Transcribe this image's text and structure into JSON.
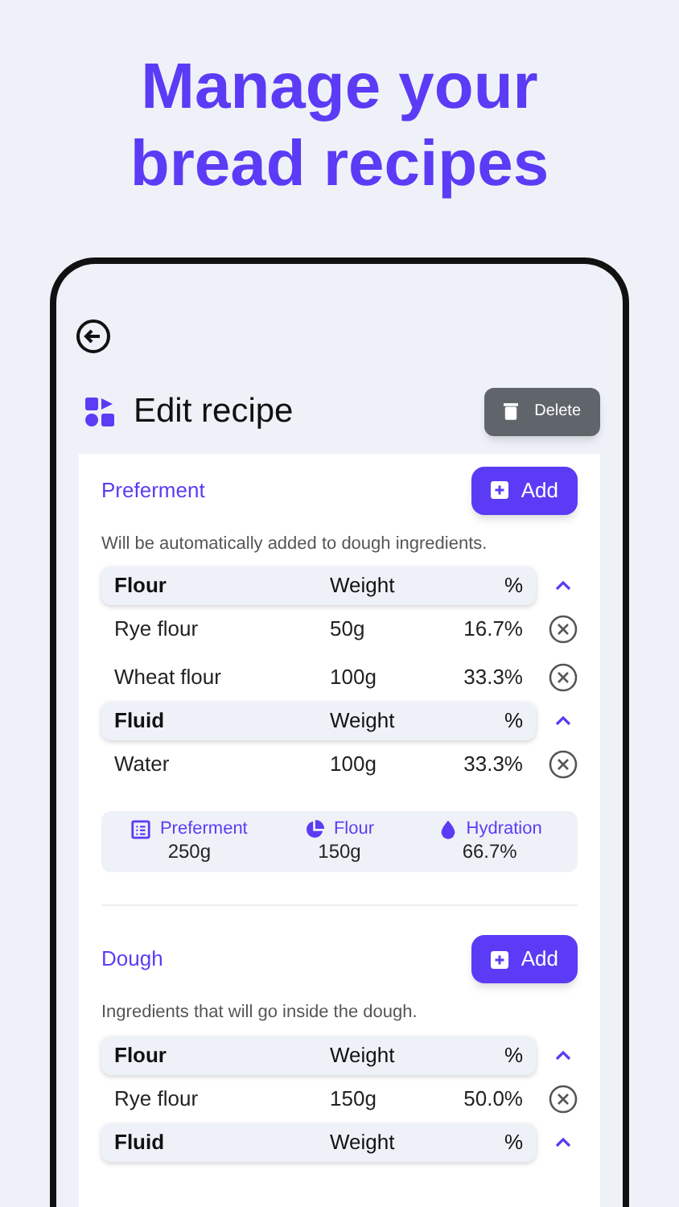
{
  "headline": "Manage your bread recipes",
  "screen": {
    "title": "Edit recipe",
    "delete_button": "Delete",
    "sections": [
      {
        "title": "Preferment",
        "add_button": "Add",
        "description": "Will be automatically added to dough ingredients.",
        "groups": [
          {
            "name": "Flour",
            "weight_header": "Weight",
            "percent_header": "%",
            "expanded": true,
            "items": [
              {
                "name": "Rye flour",
                "weight": "50g",
                "percent": "16.7%"
              },
              {
                "name": "Wheat flour",
                "weight": "100g",
                "percent": "33.3%"
              }
            ]
          },
          {
            "name": "Fluid",
            "weight_header": "Weight",
            "percent_header": "%",
            "expanded": true,
            "items": [
              {
                "name": "Water",
                "weight": "100g",
                "percent": "33.3%"
              }
            ]
          }
        ],
        "summary": [
          {
            "kind": "list",
            "label": "Preferment",
            "value": "250g"
          },
          {
            "kind": "pie",
            "label": "Flour",
            "value": "150g"
          },
          {
            "kind": "drop",
            "label": "Hydration",
            "value": "66.7%"
          }
        ]
      },
      {
        "title": "Dough",
        "add_button": "Add",
        "description": "Ingredients that will go inside the dough.",
        "groups": [
          {
            "name": "Flour",
            "weight_header": "Weight",
            "percent_header": "%",
            "expanded": true,
            "items": [
              {
                "name": "Rye flour",
                "weight": "150g",
                "percent": "50.0%"
              }
            ]
          },
          {
            "name": "Fluid",
            "weight_header": "Weight",
            "percent_header": "%",
            "expanded": true
          }
        ]
      }
    ]
  }
}
